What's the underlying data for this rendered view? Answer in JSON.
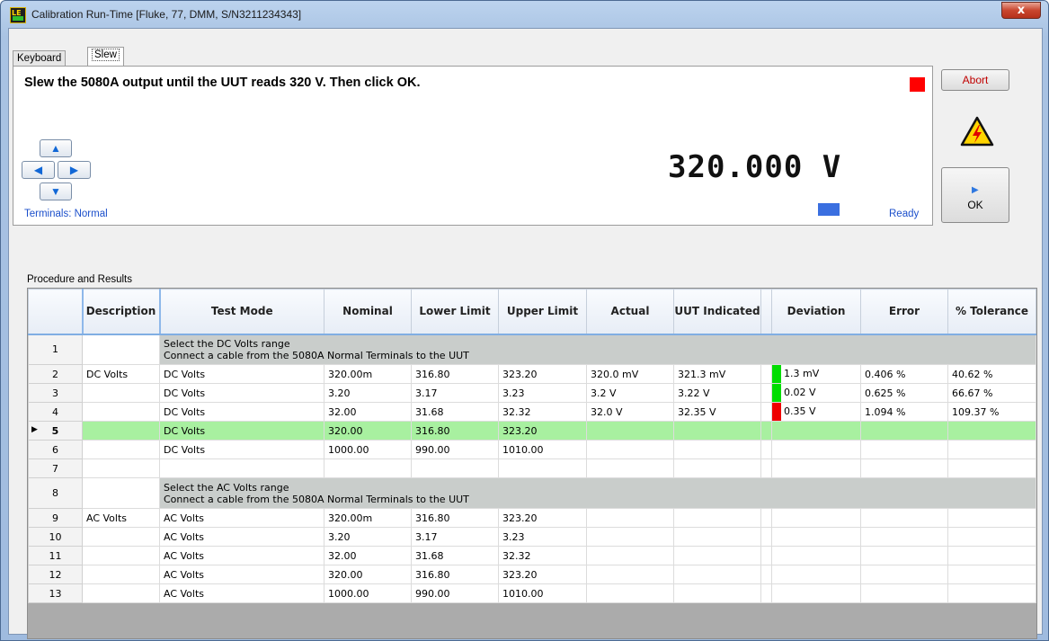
{
  "window": {
    "title": "Calibration Run-Time [Fluke, 77, DMM, S/N3211234343]",
    "close_glyph": "x"
  },
  "tabs": [
    {
      "label": "Keyboard",
      "active": false
    },
    {
      "label": "Slew",
      "active": true
    }
  ],
  "instruction": "Slew the 5080A output until the UUT reads 320 V. Then click OK.",
  "status_indicator_color": "#ff0000",
  "slew_buttons": {
    "up": "▲",
    "left": "◀",
    "right": "▶",
    "down": "▼"
  },
  "terminals": "Terminals: Normal",
  "readout": "320.000 V",
  "ready": "Ready",
  "buttons": {
    "abort": "Abort",
    "ok": "OK",
    "ok_glyph": "▶"
  },
  "warning_icon": "high-voltage-warning-icon",
  "section_label": "Procedure and Results",
  "table": {
    "columns": [
      "",
      "Description",
      "Test Mode",
      "Nominal",
      "Lower Limit",
      "Upper Limit",
      "Actual",
      "UUT Indicated",
      "",
      "Deviation",
      "Error",
      "% Tolerance"
    ],
    "rows": [
      {
        "num": "1",
        "note": [
          "Select the DC Volts range",
          "Connect a cable from the 5080A Normal Terminals to the UUT"
        ]
      },
      {
        "num": "2",
        "description": "DC Volts",
        "test_mode": "DC Volts",
        "nominal": "320.00m",
        "lower": "316.80",
        "upper": "323.20",
        "actual": "320.0 mV",
        "uut": "321.3 mV",
        "status": "pass",
        "deviation": "1.3 mV",
        "error": "0.406 %",
        "tolerance": "40.62 %"
      },
      {
        "num": "3",
        "description": "",
        "test_mode": "DC Volts",
        "nominal": "3.20",
        "lower": "3.17",
        "upper": "3.23",
        "actual": "3.2 V",
        "uut": "3.22 V",
        "status": "pass",
        "deviation": "0.02 V",
        "error": "0.625 %",
        "tolerance": "66.67 %"
      },
      {
        "num": "4",
        "description": "",
        "test_mode": "DC Volts",
        "nominal": "32.00",
        "lower": "31.68",
        "upper": "32.32",
        "actual": "32.0 V",
        "uut": "32.35 V",
        "status": "fail",
        "deviation": "0.35 V",
        "error": "1.094 %",
        "tolerance": "109.37 %"
      },
      {
        "num": "5",
        "description": "",
        "test_mode": "DC Volts",
        "nominal": "320.00",
        "lower": "316.80",
        "upper": "323.20",
        "actual": "",
        "uut": "",
        "status": "",
        "deviation": "",
        "error": "",
        "tolerance": "",
        "current": true
      },
      {
        "num": "6",
        "description": "",
        "test_mode": "DC Volts",
        "nominal": "1000.00",
        "lower": "990.00",
        "upper": "1010.00",
        "actual": "",
        "uut": "",
        "status": "",
        "deviation": "",
        "error": "",
        "tolerance": ""
      },
      {
        "num": "7",
        "description": "",
        "test_mode": "",
        "nominal": "",
        "lower": "",
        "upper": "",
        "actual": "",
        "uut": "",
        "status": "",
        "deviation": "",
        "error": "",
        "tolerance": "",
        "blank": true
      },
      {
        "num": "8",
        "note": [
          "Select the AC Volts range",
          "Connect a cable from the 5080A Normal Terminals to the UUT"
        ]
      },
      {
        "num": "9",
        "description": "AC Volts",
        "test_mode": "AC Volts",
        "nominal": "320.00m",
        "lower": "316.80",
        "upper": "323.20",
        "actual": "",
        "uut": "",
        "status": "",
        "deviation": "",
        "error": "",
        "tolerance": ""
      },
      {
        "num": "10",
        "description": "",
        "test_mode": "AC Volts",
        "nominal": "3.20",
        "lower": "3.17",
        "upper": "3.23",
        "actual": "",
        "uut": "",
        "status": "",
        "deviation": "",
        "error": "",
        "tolerance": ""
      },
      {
        "num": "11",
        "description": "",
        "test_mode": "AC Volts",
        "nominal": "32.00",
        "lower": "31.68",
        "upper": "32.32",
        "actual": "",
        "uut": "",
        "status": "",
        "deviation": "",
        "error": "",
        "tolerance": ""
      },
      {
        "num": "12",
        "description": "",
        "test_mode": "AC Volts",
        "nominal": "320.00",
        "lower": "316.80",
        "upper": "323.20",
        "actual": "",
        "uut": "",
        "status": "",
        "deviation": "",
        "error": "",
        "tolerance": ""
      },
      {
        "num": "13",
        "description": "",
        "test_mode": "AC Volts",
        "nominal": "1000.00",
        "lower": "990.00",
        "upper": "1010.00",
        "actual": "",
        "uut": "",
        "status": "",
        "deviation": "",
        "error": "",
        "tolerance": ""
      }
    ]
  },
  "colors": {
    "pass": "#00dd00",
    "fail": "#ee0000",
    "current_row": "#a8f0a0",
    "note_row": "#c9cdcb"
  }
}
